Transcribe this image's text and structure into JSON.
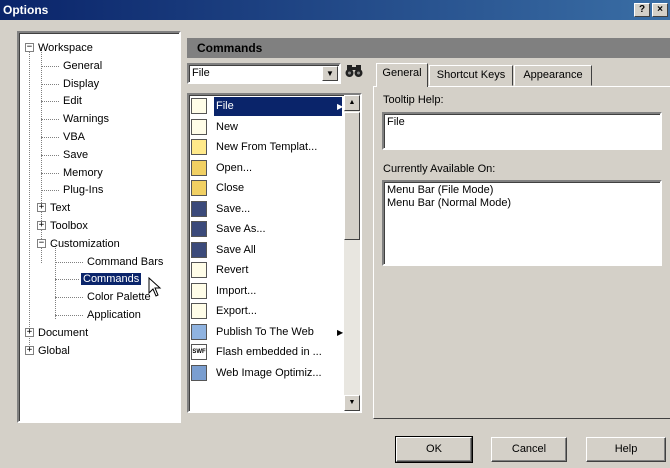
{
  "window": {
    "title": "Options",
    "help_btn": "?",
    "close_btn": "×"
  },
  "tree": {
    "items": [
      {
        "label": "Workspace",
        "expander": "−"
      },
      {
        "label": "General"
      },
      {
        "label": "Display"
      },
      {
        "label": "Edit"
      },
      {
        "label": "Warnings"
      },
      {
        "label": "VBA"
      },
      {
        "label": "Save"
      },
      {
        "label": "Memory"
      },
      {
        "label": "Plug-Ins"
      },
      {
        "label": "Text",
        "expander": "+"
      },
      {
        "label": "Toolbox",
        "expander": "+"
      },
      {
        "label": "Customization",
        "expander": "−"
      },
      {
        "label": "Command Bars"
      },
      {
        "label": "Commands",
        "selected": true
      },
      {
        "label": "Color Palette"
      },
      {
        "label": "Application"
      },
      {
        "label": "Document",
        "expander": "+"
      },
      {
        "label": "Global",
        "expander": "+"
      }
    ]
  },
  "commands": {
    "header": "Commands",
    "category_value": "File",
    "combo_arrow": "▼",
    "find_icon": "binoculars-icon",
    "items": [
      {
        "label": "File",
        "icon": "page-icon",
        "submenu_arrow": "▶",
        "selected": true
      },
      {
        "label": "New",
        "icon": "new-page-icon"
      },
      {
        "label": "New From Templat...",
        "icon": "template-icon"
      },
      {
        "label": "Open...",
        "icon": "open-folder-icon"
      },
      {
        "label": "Close",
        "icon": "close-folder-icon"
      },
      {
        "label": "Save...",
        "icon": "floppy-icon"
      },
      {
        "label": "Save As...",
        "icon": "floppy-icon"
      },
      {
        "label": "Save All",
        "icon": "floppy-icon"
      },
      {
        "label": "Revert",
        "icon": "revert-icon"
      },
      {
        "label": "Import...",
        "icon": "import-icon"
      },
      {
        "label": "Export...",
        "icon": "export-icon"
      },
      {
        "label": "Publish To The Web",
        "icon": "web-icon",
        "submenu_arrow": "▶"
      },
      {
        "label": "Flash embedded in ...",
        "icon": "swf-icon",
        "icon_text": "SWF"
      },
      {
        "label": "Web Image Optimiz...",
        "icon": "web-image-icon"
      }
    ],
    "scroll_up": "▲",
    "scroll_down": "▼"
  },
  "tabs": [
    {
      "label": "General",
      "active": true
    },
    {
      "label": "Shortcut Keys"
    },
    {
      "label": "Appearance"
    }
  ],
  "general_panel": {
    "tooltip_label": "Tooltip Help:",
    "tooltip_value": "File",
    "available_label": "Currently Available On:",
    "available_lines": [
      "Menu Bar (File Mode)",
      "Menu Bar (Normal Mode)"
    ]
  },
  "buttons": {
    "ok": "OK",
    "cancel": "Cancel",
    "help": "Help"
  }
}
